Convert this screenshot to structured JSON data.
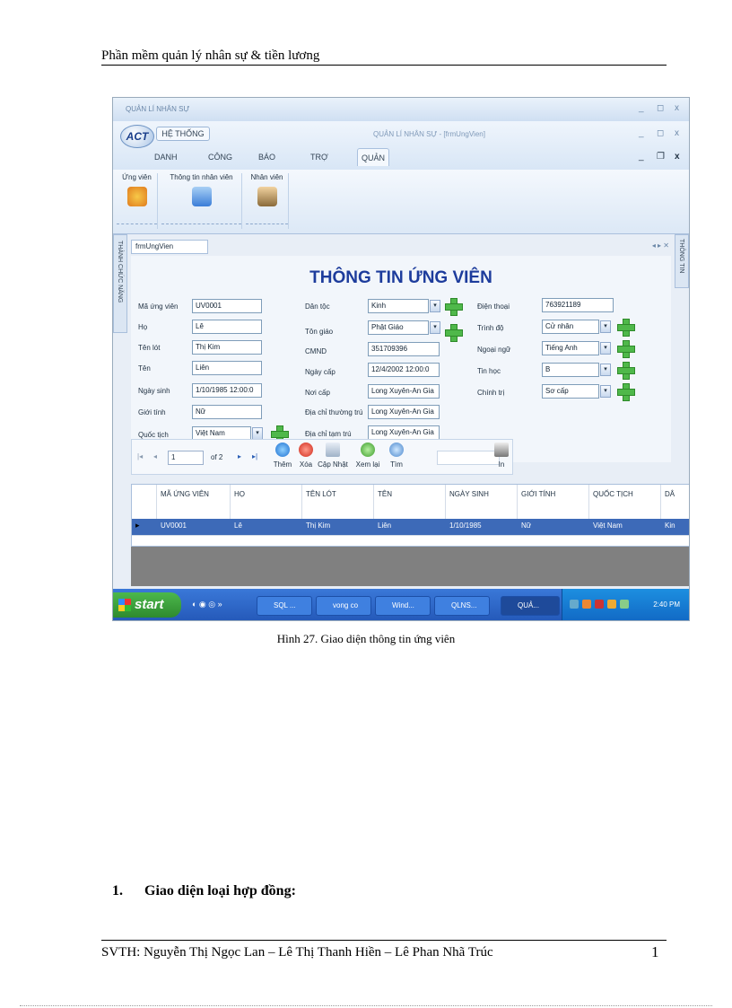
{
  "page": {
    "header": "Phần mềm quản lý nhân sự & tiền lương",
    "caption": "Hình 27. Giao diện thông tin ứng viên",
    "section_number": "1.",
    "section_title": "Giao diện loại hợp đồng:",
    "footer": "SVTH: Nguyễn Thị Ngọc Lan – Lê Thị Thanh Hiền – Lê Phan Nhã Trúc",
    "page_number": "1"
  },
  "app": {
    "window_title": "QUẢN LÍ NHÂN SỰ",
    "inner_title": "QUẢN LÍ NHÂN SỰ - [frmUngVien]",
    "logo": "ACT",
    "system_menu": "HỆ THỐNG",
    "tabs": [
      "DANH MỤC",
      "CÔNG CỤ",
      "BÁO CÁO",
      "TRỢ GIÚP",
      "QUẢN LÝ NHÂN SỰ"
    ],
    "ribbon": [
      "Ứng viên",
      "Thông tin nhân viên",
      "Nhân viên"
    ],
    "side_left": "THÀNH CHỨC NĂNG",
    "side_right": "THÔNG TIN",
    "doc_tab": "frmUngVien"
  },
  "form": {
    "title": "THÔNG TIN ỨNG VIÊN",
    "col1": [
      {
        "label": "Mã ứng viên",
        "value": "UV0001"
      },
      {
        "label": "Họ",
        "value": "Lê"
      },
      {
        "label": "Tên lót",
        "value": "Thị Kim"
      },
      {
        "label": "Tên",
        "value": "Liên"
      },
      {
        "label": "Ngày sinh",
        "value": "1/10/1985 12:00:0"
      },
      {
        "label": "Giới tính",
        "value": "Nữ"
      },
      {
        "label": "Quốc tịch",
        "value": "Việt Nam"
      }
    ],
    "col2": [
      {
        "label": "Dân tộc",
        "value": "Kinh"
      },
      {
        "label": "Tôn giáo",
        "value": "Phật Giáo"
      },
      {
        "label": "CMND",
        "value": "351709396"
      },
      {
        "label": "Ngày cấp",
        "value": "12/4/2002 12:00:0"
      },
      {
        "label": "Nơi cấp",
        "value": "Long Xuyên-An Gia"
      },
      {
        "label": "Địa chỉ thường trú",
        "value": "Long Xuyên-An Gia"
      },
      {
        "label": "Địa chỉ tạm trú",
        "value": "Long Xuyên-An Gia"
      }
    ],
    "col3": [
      {
        "label": "Điện thoại",
        "value": "763921189"
      },
      {
        "label": "Trình độ",
        "value": "Cử nhân"
      },
      {
        "label": "Ngoại ngữ",
        "value": "Tiếng Anh"
      },
      {
        "label": "Tin học",
        "value": "B"
      },
      {
        "label": "Chính trị",
        "value": "Sơ cấp"
      }
    ]
  },
  "navigator": {
    "position": "1",
    "of_text": "of 2",
    "buttons": [
      "Thêm",
      "Xóa",
      "Cập Nhật",
      "Xem lại",
      "Tìm",
      "In"
    ]
  },
  "grid": {
    "headers": [
      "MÃ ỨNG VIÊN",
      "HỌ",
      "TÊN LÓT",
      "TÊN",
      "NGÀY SINH",
      "GIỚI TÍNH",
      "QUỐC TỊCH",
      "DÂ"
    ],
    "row": [
      "UV0001",
      "Lê",
      "Thị Kim",
      "Liên",
      "1/10/1985",
      "Nữ",
      "Việt Nam",
      "Kin"
    ]
  },
  "taskbar": {
    "start": "start",
    "items": [
      "SQL ...",
      "vong co",
      "Wind...",
      "QLNS...",
      "QUẢ..."
    ],
    "clock": "2:40 PM"
  }
}
